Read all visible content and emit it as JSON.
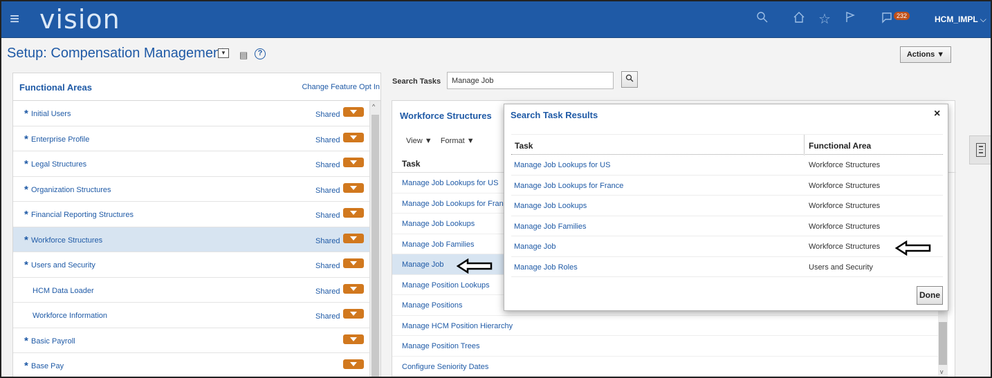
{
  "header": {
    "app_name": "vision",
    "menu_icon": "hamburger-icon",
    "icons": [
      "search-icon",
      "home-icon",
      "star-icon",
      "flag-icon",
      "notifications-icon"
    ],
    "notification_count": "232",
    "user": "HCM_IMPL"
  },
  "page": {
    "title": "Setup: Compensation Management",
    "actions_label": "Actions ▼"
  },
  "functional_areas": {
    "title": "Functional Areas",
    "change_link": "Change Feature Opt In",
    "items": [
      {
        "label": "Initial Users",
        "required": true,
        "shared": "Shared"
      },
      {
        "label": "Enterprise Profile",
        "required": true,
        "shared": "Shared"
      },
      {
        "label": "Legal Structures",
        "required": true,
        "shared": "Shared"
      },
      {
        "label": "Organization Structures",
        "required": true,
        "shared": "Shared"
      },
      {
        "label": "Financial Reporting Structures",
        "required": true,
        "shared": "Shared"
      },
      {
        "label": "Workforce Structures",
        "required": true,
        "shared": "Shared",
        "selected": true
      },
      {
        "label": "Users and Security",
        "required": true,
        "shared": "Shared"
      },
      {
        "label": "HCM Data Loader",
        "required": false,
        "shared": "Shared"
      },
      {
        "label": "Workforce Information",
        "required": false,
        "shared": "Shared"
      },
      {
        "label": "Basic Payroll",
        "required": true,
        "shared": ""
      },
      {
        "label": "Base Pay",
        "required": true,
        "shared": ""
      }
    ]
  },
  "search": {
    "label": "Search Tasks",
    "value": "Manage Job"
  },
  "workforce": {
    "title": "Workforce Structures",
    "view_label": "View ▼",
    "format_label": "Format ▼",
    "task_header": "Task",
    "tasks": [
      "Manage Job Lookups for US",
      "Manage Job Lookups for France",
      "Manage Job Lookups",
      "Manage Job Families",
      "Manage Job",
      "Manage Position Lookups",
      "Manage Positions",
      "Manage HCM Position Hierarchy",
      "Manage Position Trees",
      "Configure Seniority Dates"
    ]
  },
  "dialog": {
    "title": "Search Task Results",
    "close": "×",
    "col_task": "Task",
    "col_area": "Functional Area",
    "rows": [
      {
        "task": "Manage Job Lookups for US",
        "area": "Workforce Structures"
      },
      {
        "task": "Manage Job Lookups for France",
        "area": "Workforce Structures"
      },
      {
        "task": "Manage Job Lookups",
        "area": "Workforce Structures"
      },
      {
        "task": "Manage Job Families",
        "area": "Workforce Structures"
      },
      {
        "task": "Manage Job",
        "area": "Workforce Structures"
      },
      {
        "task": "Manage Job Roles",
        "area": "Users and Security"
      }
    ],
    "done_label": "Done"
  },
  "colors": {
    "header_bg": "#1f5aa6",
    "link": "#1f5aa6",
    "orange_button": "#d1781e",
    "selected_row": "#d7e4f1"
  }
}
